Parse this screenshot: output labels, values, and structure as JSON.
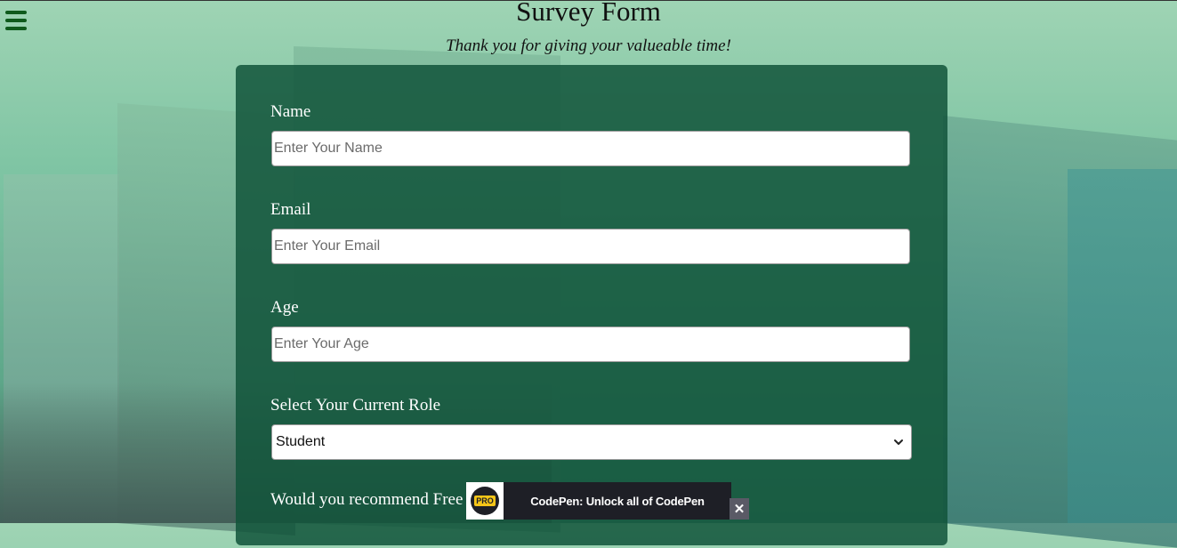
{
  "header": {
    "title": "Survey Form",
    "subtitle": "Thank you for giving your valueable time!"
  },
  "menu": {
    "icon": "hamburger-icon"
  },
  "form": {
    "name": {
      "label": "Name",
      "placeholder": "Enter Your Name"
    },
    "email": {
      "label": "Email",
      "placeholder": "Enter Your Email"
    },
    "age": {
      "label": "Age",
      "placeholder": "Enter Your Age"
    },
    "role": {
      "label": "Select Your Current Role",
      "selected": "Student"
    },
    "recommend": {
      "label": "Would you recommend Free"
    }
  },
  "codepen_banner": {
    "badge": "PRO",
    "text": "CodePen: Unlock all of CodePen",
    "close": "✕"
  },
  "colors": {
    "card": "#11543a",
    "menu_icon": "#0f5a1c",
    "banner": "#1e1f26",
    "pro_badge": "#f5c518"
  }
}
